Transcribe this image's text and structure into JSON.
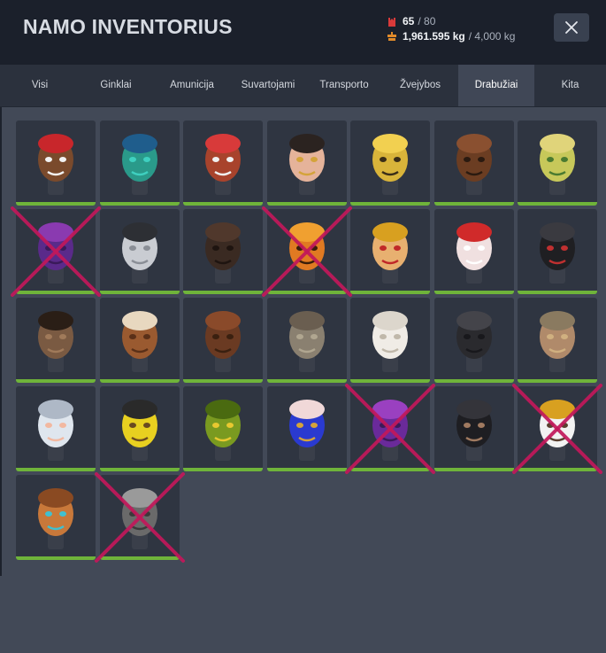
{
  "header": {
    "title": "NAMO INVENTORIUS",
    "slots": {
      "current": "65",
      "max": "/ 80"
    },
    "weight": {
      "current": "1,961.595 kg",
      "max": "/ 4,000 kg"
    },
    "close_icon": "close-icon"
  },
  "tabs": [
    {
      "label": "Visi",
      "active": false
    },
    {
      "label": "Ginklai",
      "active": false
    },
    {
      "label": "Amunicija",
      "active": false
    },
    {
      "label": "Suvartojami",
      "active": false
    },
    {
      "label": "Transporto",
      "active": false
    },
    {
      "label": "Žvejybos",
      "active": false
    },
    {
      "label": "Drabužiai",
      "active": true
    },
    {
      "label": "Kita",
      "active": false
    }
  ],
  "colors": {
    "accent_bar": "#6fb43a",
    "cross_mark": "#c2185b",
    "slot_icon": "#d93a3a",
    "weight_icon": "#e08a2a"
  },
  "items": [
    {
      "icon": "santa-mask-icon",
      "crossed": false
    },
    {
      "icon": "teal-face-paint-mask-icon",
      "crossed": false
    },
    {
      "icon": "flag-face-paint-mask-icon",
      "crossed": false
    },
    {
      "icon": "queen-mask-icon",
      "crossed": false
    },
    {
      "icon": "corn-mask-icon",
      "crossed": false
    },
    {
      "icon": "bear-mask-icon",
      "crossed": false
    },
    {
      "icon": "alien-mask-icon",
      "crossed": false
    },
    {
      "icon": "purple-skull-mask-icon",
      "crossed": true
    },
    {
      "icon": "balaclava-white-mask-icon",
      "crossed": false
    },
    {
      "icon": "horse-dark-mask-icon",
      "crossed": false
    },
    {
      "icon": "pumpkin-mask-icon",
      "crossed": true
    },
    {
      "icon": "king-mask-icon",
      "crossed": false
    },
    {
      "icon": "clown-queen-mask-icon",
      "crossed": false
    },
    {
      "icon": "black-monster-mask-icon",
      "crossed": false
    },
    {
      "icon": "pug-mask-icon",
      "crossed": false
    },
    {
      "icon": "horse-brown-mask-icon",
      "crossed": false
    },
    {
      "icon": "bear-brown-mask-icon",
      "crossed": false
    },
    {
      "icon": "cat-mask-icon",
      "crossed": false
    },
    {
      "icon": "chicken-mask-icon",
      "crossed": false
    },
    {
      "icon": "black-face-mask-icon",
      "crossed": false
    },
    {
      "icon": "gas-mask-icon",
      "crossed": false
    },
    {
      "icon": "old-man-mask-icon",
      "crossed": false
    },
    {
      "icon": "yellow-goggles-mask-icon",
      "crossed": false
    },
    {
      "icon": "green-zombie-mask-icon",
      "crossed": false
    },
    {
      "icon": "blue-queen-mask-icon",
      "crossed": false
    },
    {
      "icon": "purple-skull-balaclava-icon",
      "crossed": true
    },
    {
      "icon": "black-balaclava-icon",
      "crossed": false
    },
    {
      "icon": "eagle-mask-icon",
      "crossed": true
    },
    {
      "icon": "walrus-mask-icon",
      "crossed": false
    },
    {
      "icon": "grey-helmet-mask-icon",
      "crossed": true
    }
  ]
}
